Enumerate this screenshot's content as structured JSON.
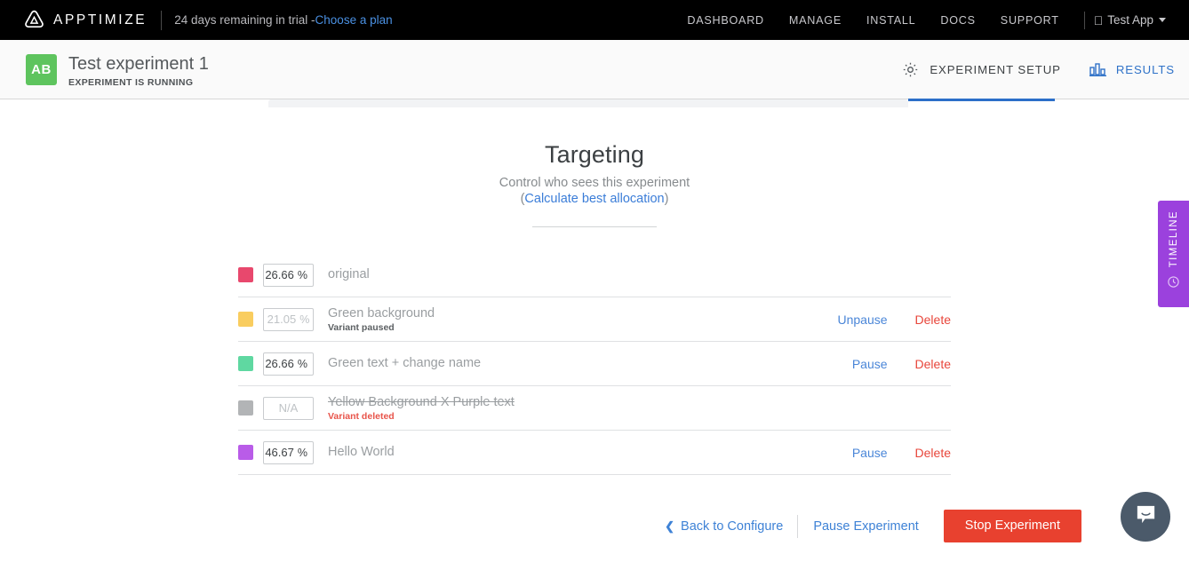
{
  "topbar": {
    "brand_name": "APPTIMIZE",
    "logo_icon": "apptimize-logo-icon",
    "trial_text": "24 days remaining in trial - ",
    "trial_link": "Choose a plan",
    "nav": [
      {
        "label": "DASHBOARD"
      },
      {
        "label": "MANAGE"
      },
      {
        "label": "INSTALL"
      },
      {
        "label": "DOCS"
      },
      {
        "label": "SUPPORT"
      }
    ],
    "app_chooser": {
      "apple_icon": "apple-icon",
      "label": "Test App",
      "caret": "chevron-down-icon"
    }
  },
  "subheader": {
    "badge": "AB",
    "title": "Test experiment 1",
    "status": "EXPERIMENT IS RUNNING",
    "tabs": [
      {
        "label": "EXPERIMENT SETUP",
        "icon": "gear-icon",
        "active": true
      },
      {
        "label": "RESULTS",
        "icon": "bar-chart-icon",
        "active": false
      }
    ]
  },
  "main": {
    "title": "Targeting",
    "subtitle": "Control who sees this experiment",
    "paren_open": "(",
    "calc_link": "Calculate best allocation",
    "paren_close": ")",
    "variants": [
      {
        "color": "#e8486d",
        "percent": "26.66",
        "unit": "%",
        "name": "original",
        "state": "",
        "deleted": false,
        "disabled": false,
        "pause_label": "",
        "delete_label": ""
      },
      {
        "color": "#f9cd5f",
        "percent": "21.05",
        "unit": "%",
        "name": "Green background",
        "state": "Variant paused",
        "deleted": false,
        "disabled": true,
        "pause_label": "Unpause",
        "delete_label": "Delete"
      },
      {
        "color": "#5fd8a1",
        "percent": "26.66",
        "unit": "%",
        "name": "Green text + change name",
        "state": "",
        "deleted": false,
        "disabled": false,
        "pause_label": "Pause",
        "delete_label": "Delete"
      },
      {
        "color": "#b2b4b6",
        "percent": "N/A",
        "unit": "",
        "name": "Yellow Background X Purple text",
        "state": "Variant deleted",
        "deleted": true,
        "disabled": true,
        "pause_label": "",
        "delete_label": ""
      },
      {
        "color": "#b95ce8",
        "percent": "46.67",
        "unit": "%",
        "name": "Hello World",
        "state": "",
        "deleted": false,
        "disabled": false,
        "pause_label": "Pause",
        "delete_label": "Delete"
      }
    ]
  },
  "footer": {
    "back_chevron": "chevron-left-icon",
    "back_label": "Back to Configure",
    "pause_label": "Pause Experiment",
    "stop_label": "Stop Experiment"
  },
  "timeline": {
    "label": "TIMELINE",
    "icon": "clock-icon"
  },
  "intercom": {
    "icon": "chat-bubble-icon"
  },
  "colors": {
    "accent_blue": "#3b7dd8",
    "danger_red": "#e8412f",
    "timeline_purple": "#9b41dd",
    "badge_green": "#5ec45e"
  }
}
